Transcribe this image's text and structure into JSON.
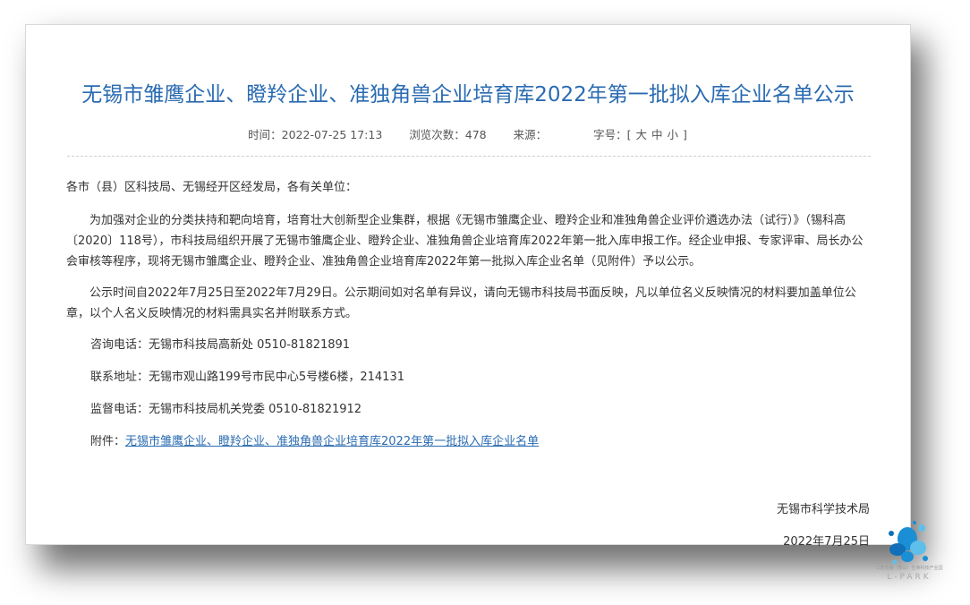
{
  "article": {
    "title": "无锡市雏鹰企业、瞪羚企业、准独角兽企业培育库2022年第一批拟入库企业名单公示",
    "meta": {
      "time_label": "时间：",
      "time_value": "2022-07-25 17:13",
      "views_label": "浏览次数：",
      "views_value": "478",
      "source_label": "来源：",
      "source_value": "",
      "fontsize_label": "字号：",
      "fontsize_open": "[",
      "fontsize_large": "大",
      "fontsize_medium": "中",
      "fontsize_small": "小",
      "fontsize_close": "]"
    },
    "salutation": "各市（县）区科技局、无锡经开区经发局，各有关单位：",
    "paragraph1": "为加强对企业的分类扶持和靶向培育，培育壮大创新型企业集群，根据《无锡市雏鹰企业、瞪羚企业和准独角兽企业评价遴选办法（试行）》（锡科高〔2020〕118号），市科技局组织开展了无锡市雏鹰企业、瞪羚企业、准独角兽企业培育库2022年第一批入库申报工作。经企业申报、专家评审、局长办公会审核等程序，现将无锡市雏鹰企业、瞪羚企业、准独角兽企业培育库2022年第一批拟入库企业名单（见附件）予以公示。",
    "paragraph2": "公示时间自2022年7月25日至2022年7月29日。公示期间如对名单有异议，请向无锡市科技局书面反映，凡以单位名义反映情况的材料要加盖单位公章，以个人名义反映情况的材料需具实名并附联系方式。",
    "consult": "咨询电话：无锡市科技局高新处  0510-81821891",
    "address": "联系地址：无锡市观山路199号市民中心5号楼6楼，214131",
    "supervise": "监督电话：无锡市科技局机关党委  0510-81821912",
    "attachment_label": "附件：",
    "attachment_link": "无锡市雏鹰企业、瞪羚企业、准独角兽企业培育库2022年第一批拟入库企业名单",
    "signature": "无锡市科学技术局",
    "date": "2022年7月25日"
  },
  "watermark": {
    "caption": "江苏无锡（惠山）生命科技产业园",
    "brand": "L-PARK",
    "colors": [
      "#1a8fd6",
      "#5ec0ea",
      "#0f6fb8"
    ]
  }
}
